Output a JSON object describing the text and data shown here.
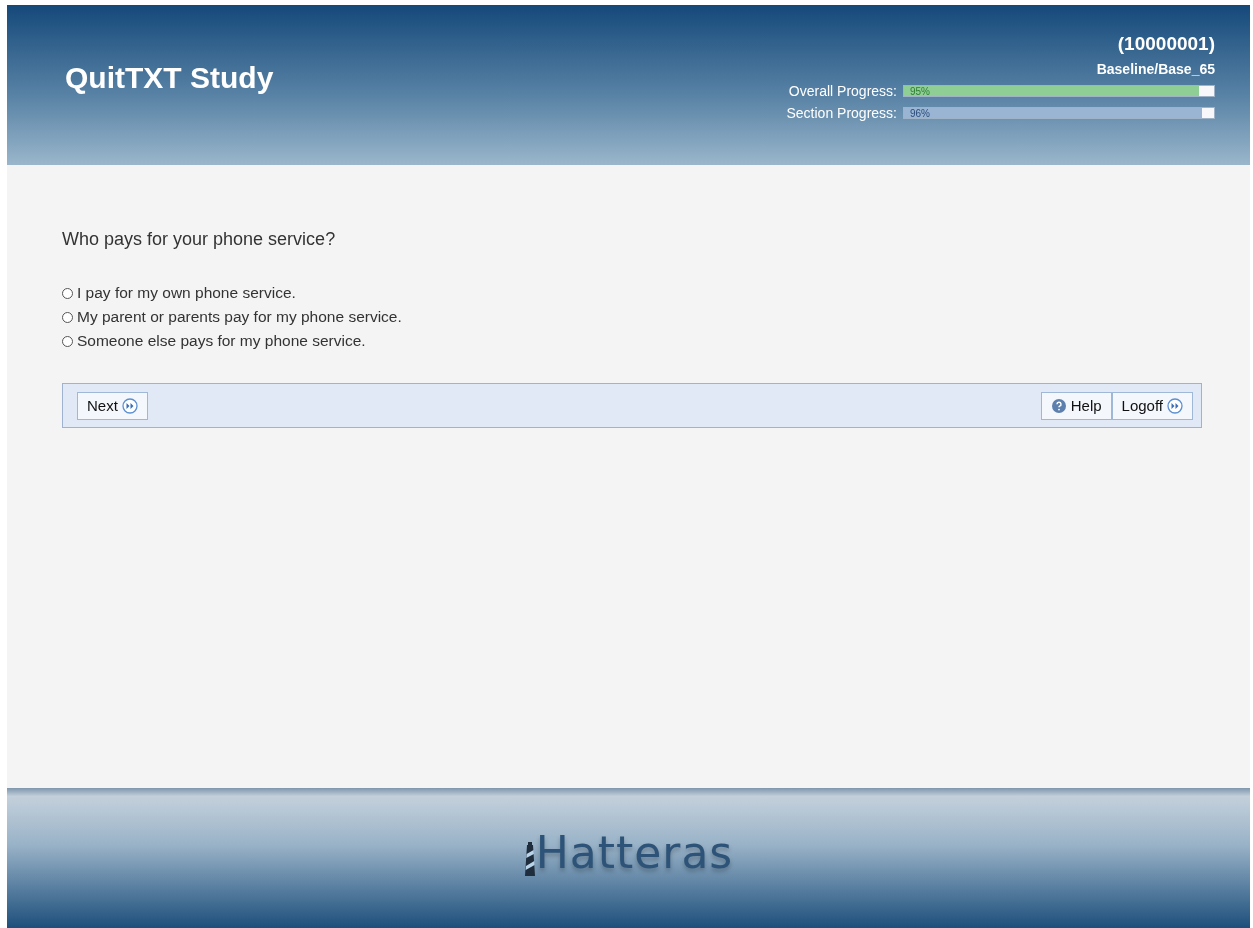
{
  "header": {
    "title": "QuitTXT Study",
    "participant_id": "(10000001)",
    "location": "Baseline/Base_65",
    "progress": [
      {
        "label": "Overall Progress:",
        "reading": "95%",
        "level": 0.95,
        "kind": "overall"
      },
      {
        "label": "Section Progress:",
        "reading": "96%",
        "level": 0.96,
        "kind": "section"
      }
    ]
  },
  "question": {
    "text": "Who pays for your phone service?",
    "options": [
      {
        "label": "I pay for my own phone service.",
        "selected": false
      },
      {
        "label": "My parent or parents pay for my phone service.",
        "selected": false
      },
      {
        "label": "Someone else pays for my phone service.",
        "selected": false
      }
    ]
  },
  "toolbar": {
    "left": [
      {
        "label": "Next",
        "kind": "forward"
      }
    ],
    "right": [
      {
        "label": "Help",
        "kind": "help"
      },
      {
        "label": "Logoff",
        "kind": "forward"
      }
    ]
  },
  "footer": {
    "logo": "Hatteras"
  }
}
